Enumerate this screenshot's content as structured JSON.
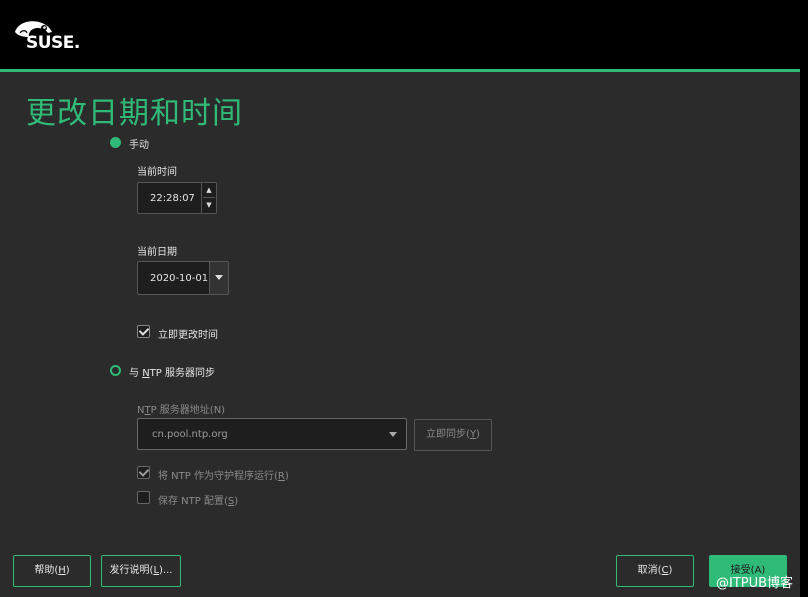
{
  "header": {
    "logo_text": "SUSE."
  },
  "page": {
    "title": "更改日期和时间"
  },
  "manual": {
    "radio_label": "手动",
    "current_time_label": "当前时间",
    "time_value": "22:28:07",
    "current_date_label": "当前日期",
    "date_value": "2020-10-01",
    "change_now_label": "立即更改时间"
  },
  "ntp": {
    "radio_pre": "与 ",
    "radio_accel": "N",
    "radio_post": "TP 服务器同步",
    "server_label_pre": "N",
    "server_label_accel": "T",
    "server_label_post": "P 服务器地址(N)",
    "server_value": "cn.pool.ntp.org",
    "sync_pre": "立即同步(",
    "sync_accel": "Y",
    "sync_post": ")",
    "daemon_pre": "将 NTP 作为守护程序运行(",
    "daemon_accel": "R",
    "daemon_post": ")",
    "save_pre": "保存 NTP 配置(",
    "save_accel": "S",
    "save_post": ")"
  },
  "buttons": {
    "help_pre": "帮助(",
    "help_accel": "H",
    "help_post": ")",
    "release_pre": "发行说明(",
    "release_accel": "L",
    "release_post": ")...",
    "cancel_pre": "取消(",
    "cancel_accel": "C",
    "cancel_post": ")",
    "accept": "接受(A)"
  },
  "watermark": "@ITPUB博客",
  "colors": {
    "accent": "#30ba78",
    "background": "#2b2b2b",
    "header": "#000000"
  }
}
